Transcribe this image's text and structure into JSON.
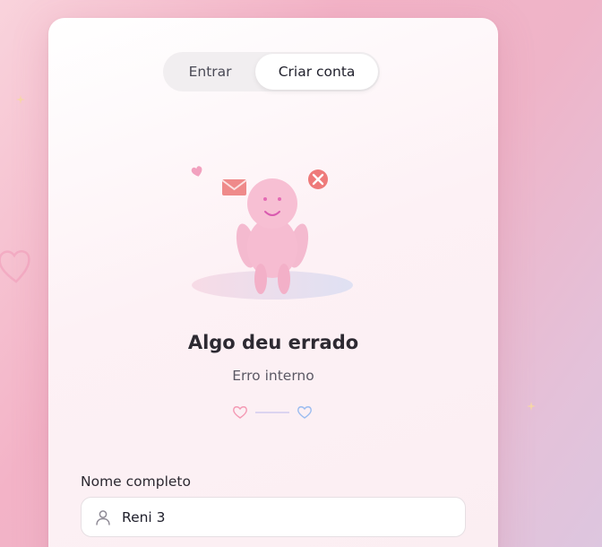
{
  "tabs": [
    {
      "label": "Entrar",
      "active": false
    },
    {
      "label": "Criar conta",
      "active": true
    }
  ],
  "error": {
    "title": "Algo deu errado",
    "message": "Erro interno"
  },
  "form": {
    "name_label": "Nome completo",
    "name_value": "Reni 3"
  },
  "icons": {
    "field_icon": "user-icon",
    "illustration": "sad-robot-illustration",
    "divider": "heart-divider"
  },
  "colors": {
    "accent_pink": "#f49ab4",
    "accent_blue": "#9bbcf0",
    "error_red": "#ee7a7a"
  }
}
